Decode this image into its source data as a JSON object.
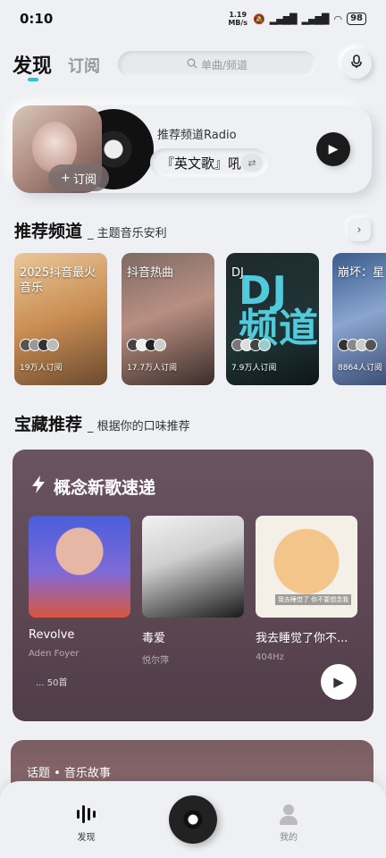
{
  "status_bar": {
    "time": "0:10",
    "net_speed": "1.19",
    "net_unit": "MB/s",
    "battery": "98"
  },
  "header": {
    "tab_discover": "发现",
    "tab_subscribe": "订阅",
    "search_placeholder": "单曲/频道"
  },
  "radio": {
    "title": "推荐频道Radio",
    "song": "『英文歌』吼",
    "subscribe_label": "订阅"
  },
  "channels_section": {
    "title": "推荐频道",
    "subtitle": "_ 主题音乐安利",
    "items": [
      {
        "title": "2025抖音最火音乐",
        "count": "19万人订阅"
      },
      {
        "title": "抖音热曲",
        "count": "17.7万人订阅"
      },
      {
        "title": "DJ",
        "count": "7.9万人订阅",
        "art": "DJ 频道"
      },
      {
        "title": "崩坏：星",
        "count": "8864人订阅"
      }
    ]
  },
  "treasure_section": {
    "title": "宝藏推荐",
    "subtitle": "_ 根据你的口味推荐",
    "card_title": "概念新歌速递",
    "songs": [
      {
        "name": "Revolve",
        "artist": "Aden Foyer"
      },
      {
        "name": "毒爱",
        "artist": "悦尔萍"
      },
      {
        "name": "我去睡觉了你不...",
        "artist": "404Hz",
        "cover_caption": "我去睡觉了 你不要想念我"
      }
    ],
    "song_count": "... 50首"
  },
  "topic": {
    "label": "话题 • 音乐故事"
  },
  "bottom_nav": {
    "discover": "发现",
    "me": "我的"
  }
}
